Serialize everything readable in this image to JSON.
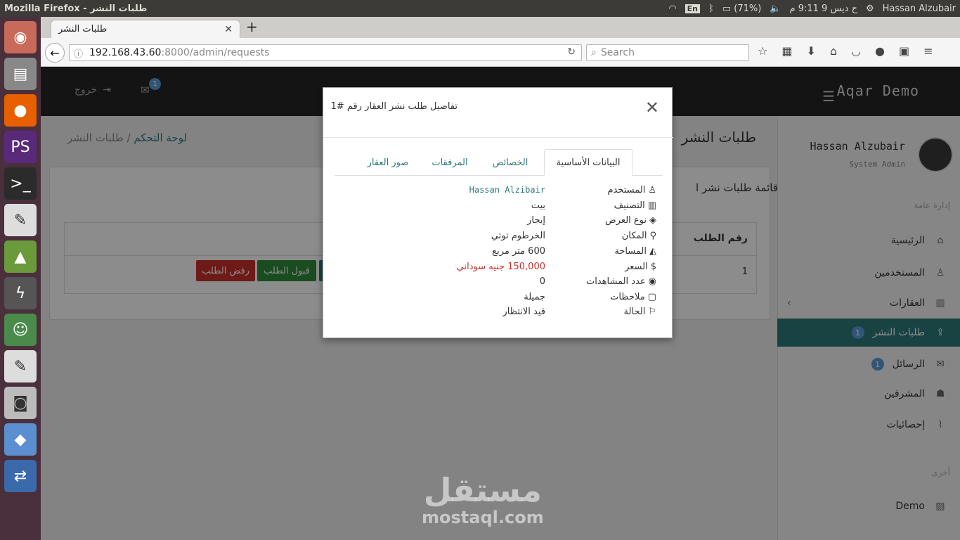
{
  "os": {
    "window_title": "Mozilla Firefox - طلبات النشر",
    "keyboard_layout": "En",
    "battery": "(71%)",
    "clock": "ح ديس 9 9:11 م",
    "user": "Hassan Alzubair"
  },
  "browser": {
    "tab_title": "طلبات النشر",
    "url_host": "192.168.43.60",
    "url_rest": ":8000/admin/requests",
    "search_placeholder": "Search"
  },
  "app": {
    "brand": "Aqar Demo",
    "logout_label": "خروج",
    "mail_badge": "1",
    "page_title": "طلبات النشر",
    "breadcrumb_home": "لوحة التحكم",
    "breadcrumb_current": "طلبات النشر"
  },
  "sidebar": {
    "user_name": "Hassan Alzubair",
    "user_role": "System Admin",
    "section_general": "إدارة عامة",
    "section_other": "أخرى",
    "items": [
      {
        "label": "الرئيسية",
        "icon": "home-icon"
      },
      {
        "label": "المستخدمين",
        "icon": "user-icon"
      },
      {
        "label": "العقارات",
        "icon": "building-icon"
      },
      {
        "label": "طلبات النشر",
        "icon": "share-icon",
        "count": "1"
      },
      {
        "label": "الرسائل",
        "icon": "mail-icon",
        "count": "1"
      },
      {
        "label": "المشرفين",
        "icon": "users-icon"
      },
      {
        "label": "إحصائيات",
        "icon": "chart-icon"
      },
      {
        "label": "Demo",
        "icon": "image-icon"
      }
    ]
  },
  "list": {
    "title": "قائمة طلبات نشر ا",
    "col_id": "رقم الطلب",
    "row_id": "1",
    "accept": "قبول الطلب",
    "reject": "رفض الطلب"
  },
  "modal": {
    "title": "تفاصيل طلب نشر العقار رقم #1",
    "tabs": [
      "البيانات الأساسية",
      "الخصائص",
      "المرفقات",
      "صور العقار"
    ],
    "rows": [
      {
        "label": "المستخدم",
        "value": "Hassan Alzibair"
      },
      {
        "label": "التصنيف",
        "value": "بيت"
      },
      {
        "label": "نوع العرض",
        "value": "إيجار"
      },
      {
        "label": "المكان",
        "value": "الخرطوم توتي"
      },
      {
        "label": "المساحة",
        "value": "600 متر مربع"
      },
      {
        "label": "السعر",
        "value": "150,000 جنيه سوداني"
      },
      {
        "label": "عدد المشاهدات",
        "value": "0"
      },
      {
        "label": "ملاحظات",
        "value": "جميلة"
      },
      {
        "label": "الحالة",
        "value": "قيد الانتظار"
      }
    ]
  },
  "watermark": {
    "ar": "مستقل",
    "en": "mostaql.com"
  },
  "colors": {
    "accent": "#2f7a7a",
    "danger": "#c9302c",
    "success": "#2e8b3a",
    "header": "#262626"
  }
}
